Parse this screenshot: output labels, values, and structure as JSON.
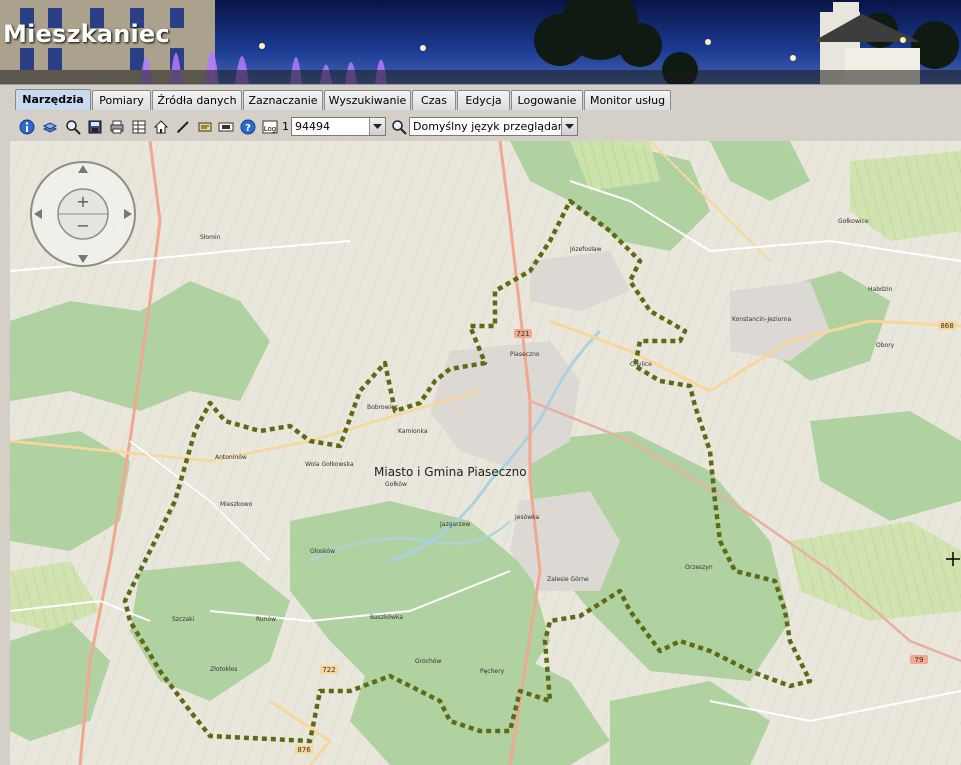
{
  "app": {
    "title": "Mieszkaniec"
  },
  "tabs": [
    {
      "label": "Narzędzia",
      "active": true
    },
    {
      "label": "Pomiary",
      "active": false
    },
    {
      "label": "Źródła danych",
      "active": false
    },
    {
      "label": "Zaznaczanie",
      "active": false
    },
    {
      "label": "Wyszukiwanie",
      "active": false
    },
    {
      "label": "Czas",
      "active": false
    },
    {
      "label": "Edycja",
      "active": false
    },
    {
      "label": "Logowanie",
      "active": false
    },
    {
      "label": "Monitor usług",
      "active": false
    }
  ],
  "toolbar": {
    "icons": [
      "info-icon",
      "layers-icon",
      "zoom-icon",
      "save-icon",
      "print-icon",
      "table-icon",
      "home-icon",
      "pen-icon",
      "bookmark-icon",
      "overview-icon",
      "help-icon",
      "log-icon"
    ],
    "log_label": "Log",
    "scale_prefix": "1 :",
    "scale_value": "94494",
    "language_value": "Domyślny język przeglądarki"
  },
  "map": {
    "area_label": "Miasto i Gmina Piaseczno",
    "boundary_color": "#5f6a14",
    "road_numbers": [
      "721",
      "79",
      "722",
      "876",
      "868"
    ],
    "place_labels": [
      "Piaseczno",
      "Konstancin-Jeziorna",
      "Józefosław",
      "Chylice",
      "Wola Gołkowska",
      "Gołków",
      "Jazgarzew",
      "Jesówka",
      "Złotokłos",
      "Szczaki",
      "Runów",
      "Gróchów",
      "Pęchery",
      "Kamionka",
      "Bobrowiec",
      "Zalesie Górne",
      "Baszkówka",
      "Głosków",
      "Orzeszyn",
      "Mieszkowo",
      "Antoninów",
      "Słomin",
      "Gołkowice",
      "Obory",
      "Habdzin"
    ]
  },
  "nav": {
    "zoom_in": "+",
    "zoom_out": "−"
  }
}
